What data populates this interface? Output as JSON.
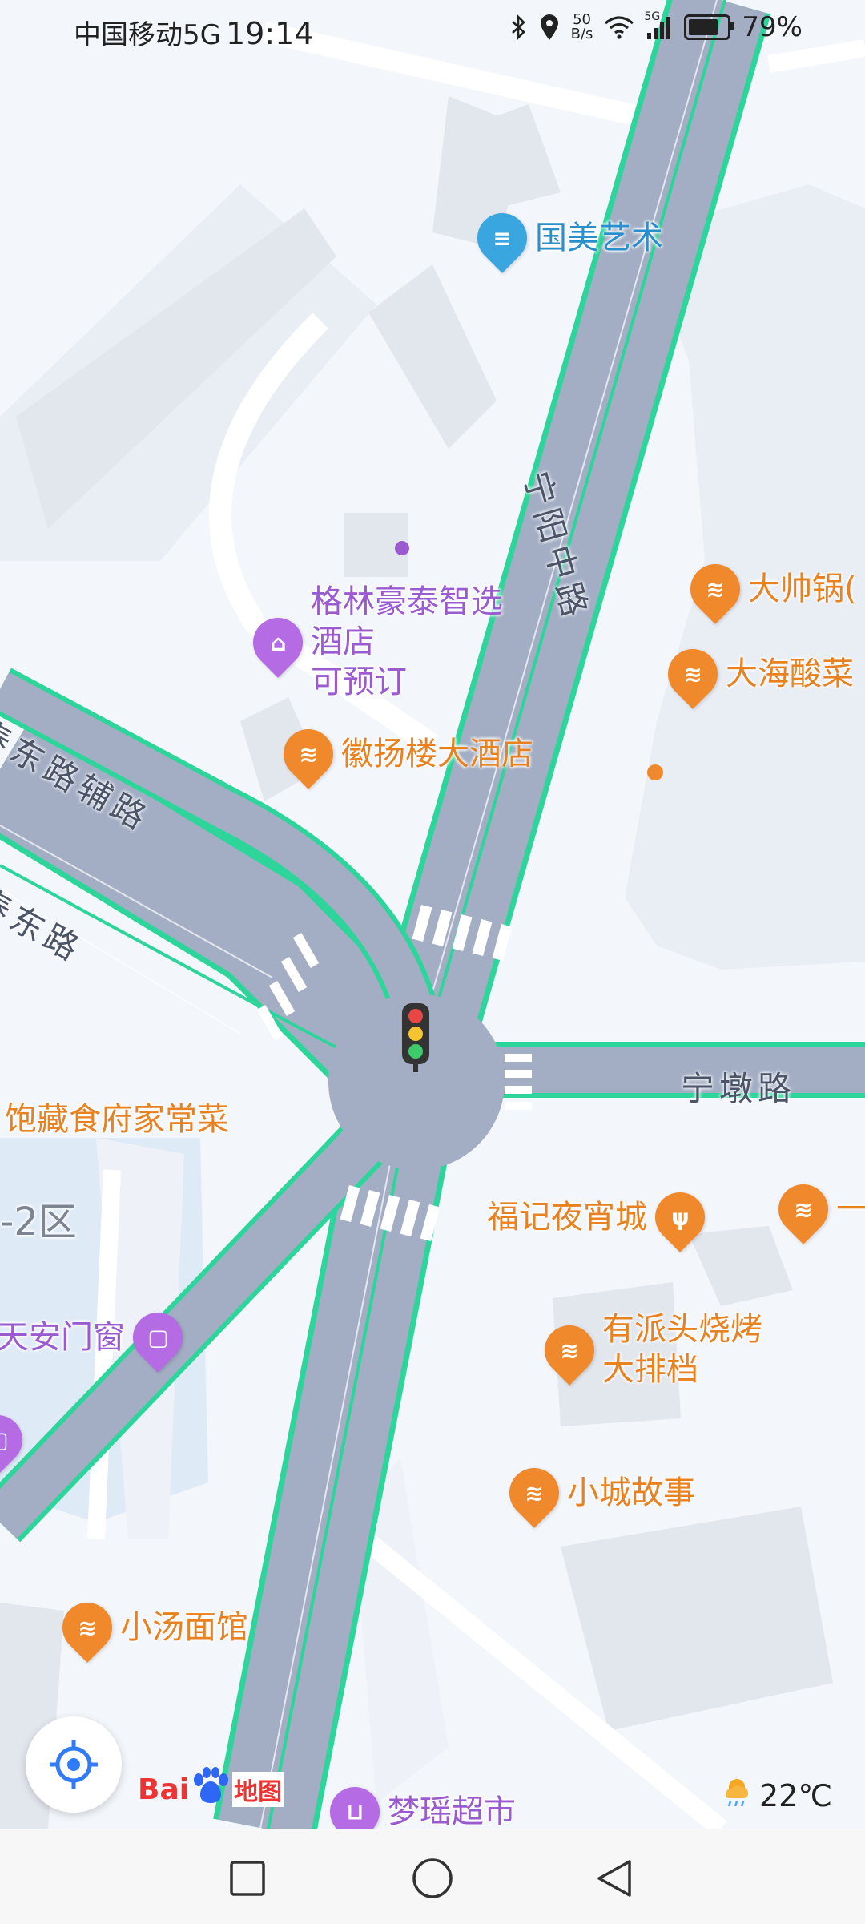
{
  "status_bar": {
    "carrier": "中国移动5G",
    "time": "19:14",
    "net_speed_value": "50",
    "net_speed_unit": "B/s",
    "signal_label": "5G",
    "battery_percent": "79%",
    "battery_level": 0.79,
    "icons": [
      "bluetooth-icon",
      "location-icon",
      "wifi-icon",
      "signal-icon",
      "battery-icon"
    ]
  },
  "map": {
    "pois": [
      {
        "name": "国美艺术",
        "category": "art",
        "color": "blue"
      },
      {
        "name": "格林豪泰智选\n酒店\n可预订",
        "category": "hotel",
        "color": "purple"
      },
      {
        "name": "徽扬楼大酒店",
        "category": "restaurant",
        "color": "orange"
      },
      {
        "name": "大帅锅(",
        "category": "restaurant",
        "color": "orange"
      },
      {
        "name": "大海酸菜",
        "category": "restaurant",
        "color": "orange"
      },
      {
        "name": "饱藏食府家常菜",
        "category": "restaurant",
        "color": "orange"
      },
      {
        "name": "福记夜宵城",
        "category": "restaurant",
        "color": "orange"
      },
      {
        "name": "一",
        "category": "restaurant",
        "color": "orange"
      },
      {
        "name": "有派头烧烤\n大排档",
        "category": "restaurant",
        "color": "orange"
      },
      {
        "name": "小城故事",
        "category": "restaurant",
        "color": "orange"
      },
      {
        "name": "天安门窗",
        "category": "shop",
        "color": "purple"
      },
      {
        "name": "小汤面馆",
        "category": "restaurant",
        "color": "orange"
      },
      {
        "name": "梦瑶超市",
        "category": "supermarket",
        "color": "purple"
      },
      {
        "name": "-2区",
        "category": "area",
        "color": "gray"
      }
    ],
    "roads": [
      "宁阳中路",
      "泰东路辅路",
      "泰东路",
      "宁墩路"
    ],
    "accent_colors": {
      "road": "#a3aec4",
      "road_edge": "#2ed59b",
      "land": "#f3f6fb",
      "block": "#e4e8ef",
      "water": "#dfeaf7"
    }
  },
  "controls": {
    "locate_icon": "locate-icon",
    "logo_text_1": "Bai",
    "logo_text_2": "地图",
    "weather_icon": "rain-cloud-icon",
    "temperature": "22℃"
  },
  "navbar": {
    "recent_icon": "square-icon",
    "home_icon": "circle-icon",
    "back_icon": "triangle-back-icon"
  }
}
